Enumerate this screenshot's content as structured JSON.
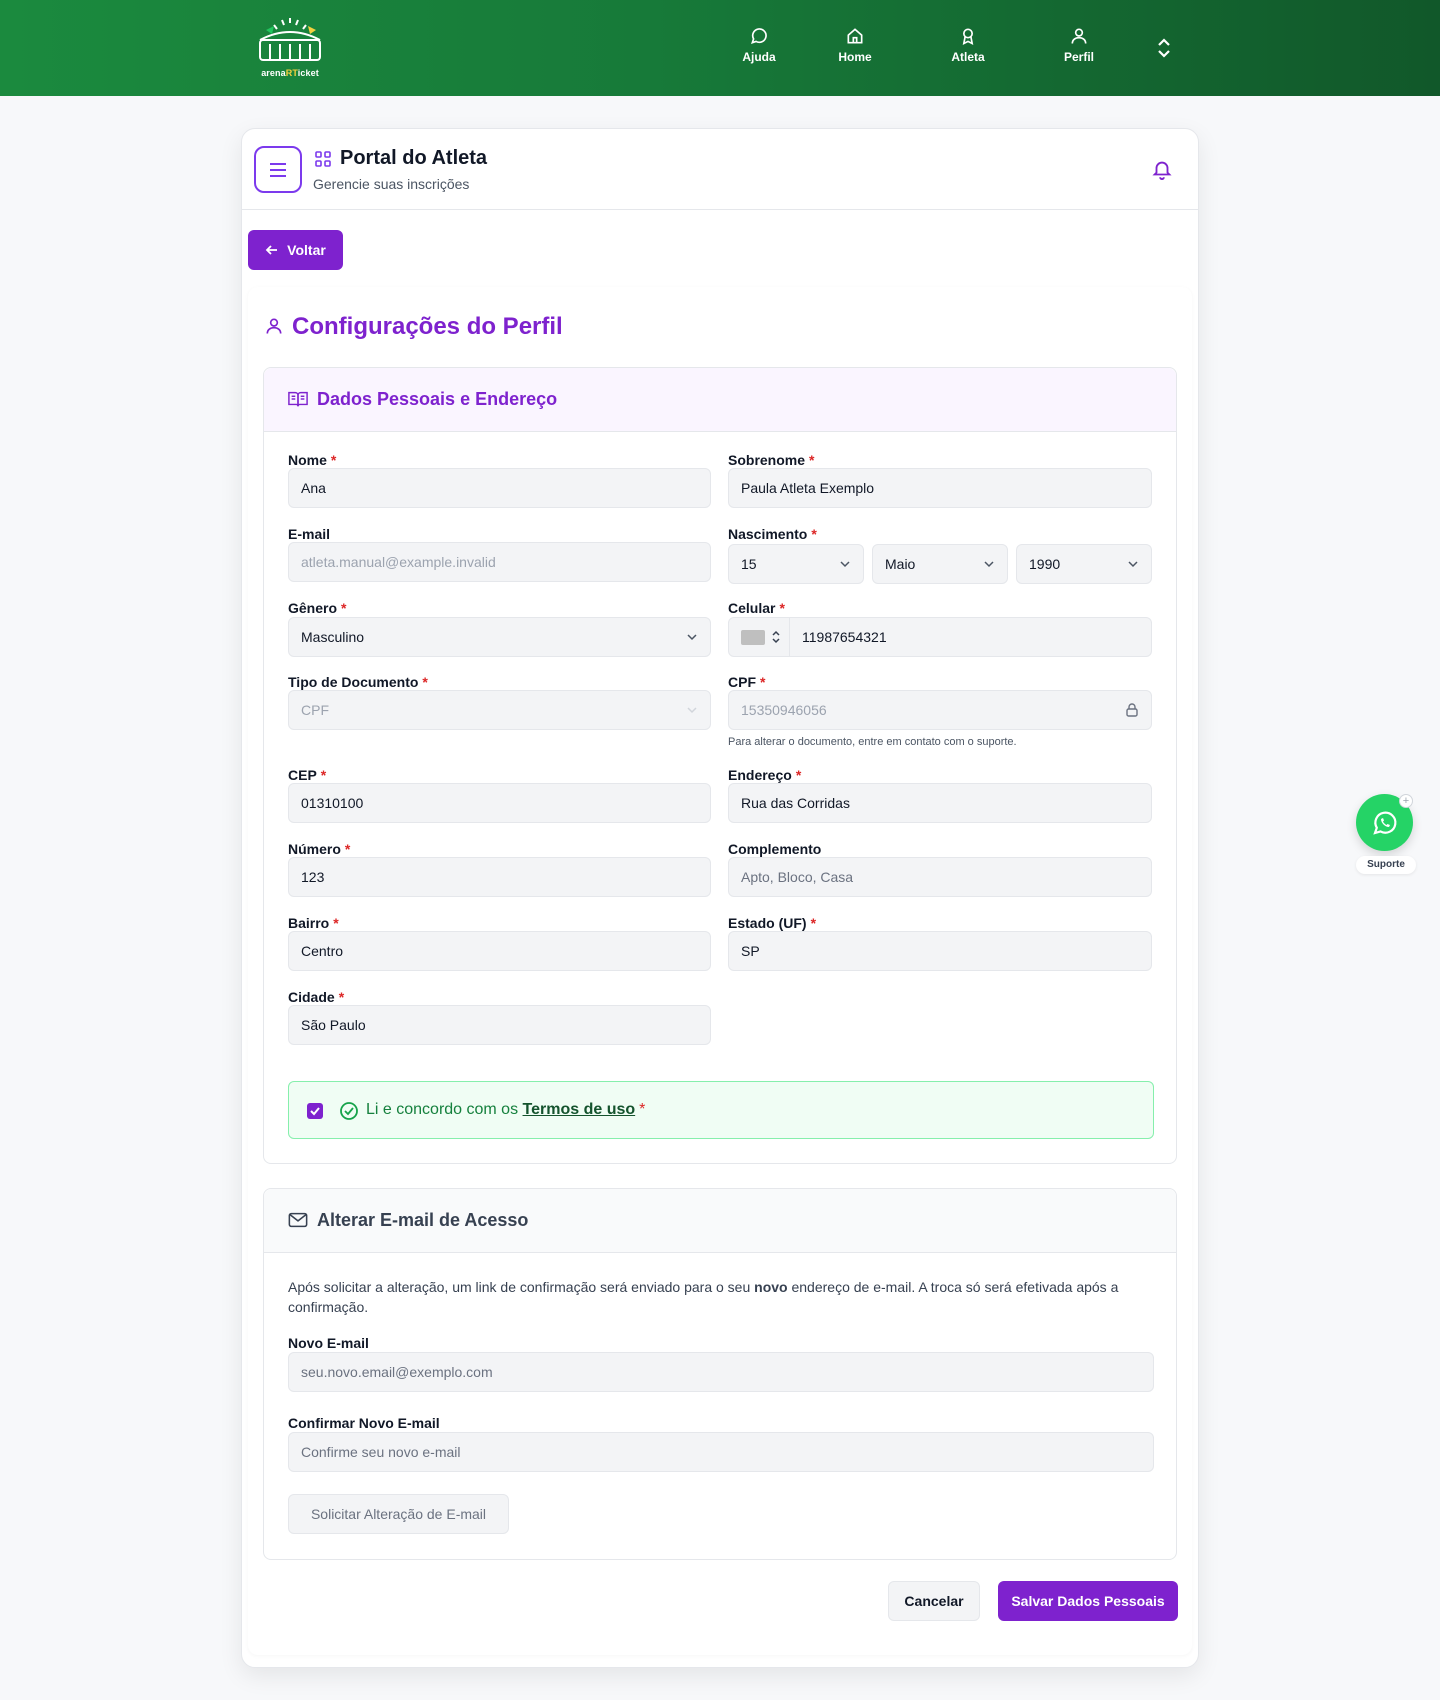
{
  "brand": {
    "logo_text_a": "arena",
    "logo_text_b": "RT",
    "logo_text_c": "icket"
  },
  "nav": [
    {
      "label": "Ajuda",
      "icon": "chat-bubble-icon"
    },
    {
      "label": "Home",
      "icon": "home-icon"
    },
    {
      "label": "Atleta",
      "icon": "medal-icon"
    },
    {
      "label": "Perfil",
      "icon": "user-icon"
    }
  ],
  "portal": {
    "title": "Portal do Atleta",
    "subtitle": "Gerencie suas inscrições"
  },
  "back_label": "Voltar",
  "page_title": "Configurações do Perfil",
  "personal": {
    "title": "Dados Pessoais e Endereço",
    "nome": {
      "label": "Nome",
      "value": "Ana"
    },
    "sobrenome": {
      "label": "Sobrenome",
      "value": "Paula Atleta Exemplo"
    },
    "email": {
      "label": "E-mail",
      "value": "atleta.manual@example.invalid"
    },
    "nascimento": {
      "label": "Nascimento",
      "day": "15",
      "month": "Maio",
      "year": "1990"
    },
    "genero": {
      "label": "Gênero",
      "value": "Masculino"
    },
    "celular": {
      "label": "Celular",
      "value": "11987654321"
    },
    "tipo_doc": {
      "label": "Tipo de Documento",
      "value": "CPF"
    },
    "cpf": {
      "label": "CPF",
      "value": "15350946056",
      "help": "Para alterar o documento, entre em contato com o suporte."
    },
    "cep": {
      "label": "CEP",
      "value": "01310100"
    },
    "endereco": {
      "label": "Endereço",
      "value": "Rua das Corridas"
    },
    "numero": {
      "label": "Número",
      "value": "123"
    },
    "complemento": {
      "label": "Complemento",
      "placeholder": "Apto, Bloco, Casa"
    },
    "bairro": {
      "label": "Bairro",
      "value": "Centro"
    },
    "estado": {
      "label": "Estado (UF)",
      "value": "SP"
    },
    "cidade": {
      "label": "Cidade",
      "value": "São Paulo"
    },
    "terms": {
      "prefix": "Li e concordo com os ",
      "link": "Termos de uso"
    }
  },
  "email_change": {
    "title": "Alterar E-mail de Acesso",
    "para_a": "Após solicitar a alteração, um link de confirmação será enviado para o seu ",
    "para_bold": "novo",
    "para_b": " endereço de e-mail. A troca só será efetivada após a confirmação.",
    "novo": {
      "label": "Novo E-mail",
      "placeholder": "seu.novo.email@exemplo.com"
    },
    "confirmar": {
      "label": "Confirmar Novo E-mail",
      "placeholder": "Confirme seu novo e-mail"
    },
    "submit_label": "Solicitar Alteração de E-mail"
  },
  "actions": {
    "cancel": "Cancelar",
    "save": "Salvar Dados Pessoais"
  },
  "support": {
    "label": "Suporte"
  },
  "colors": {
    "primary": "#7e22ce",
    "header_green": "#177a39",
    "success": "#15803d",
    "whatsapp": "#25d366"
  }
}
